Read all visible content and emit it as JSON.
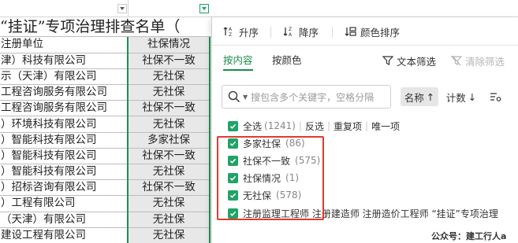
{
  "sheet": {
    "title": "“挂证”专项治理排查名单（",
    "header": {
      "col_a": "注册单位",
      "col_b": "社保情况"
    },
    "rows": [
      {
        "a": "津）科技有限公司",
        "b": "社保不一致"
      },
      {
        "a": "示（天津）有限公司",
        "b": "无社保"
      },
      {
        "a": "工程咨询服务有限公司",
        "b": "无社保"
      },
      {
        "a": "工程咨询服务有限公司",
        "b": "社保不一致"
      },
      {
        "a": "）环境科技有限公司",
        "b": "无社保"
      },
      {
        "a": "）智能科技有限公司",
        "b": "多家社保"
      },
      {
        "a": "）智能科技有限公司",
        "b": "社保不一致"
      },
      {
        "a": "）智能科技有限公司",
        "b": "无社保"
      },
      {
        "a": "）招标咨询有限公司",
        "b": "社保不一致"
      },
      {
        "a": "）工程有限公司",
        "b": "无社保"
      },
      {
        "a": "（天津）有限公司",
        "b": "无社保"
      },
      {
        "a": "建设工程有限公司",
        "b": "无社保"
      }
    ]
  },
  "panel": {
    "toolbar": {
      "asc": "升序",
      "desc": "降序",
      "color_sort": "颜色排序"
    },
    "tabs": {
      "by_content": "按内容",
      "by_color": "按颜色"
    },
    "text_filter": "文本筛选",
    "clear_filter": "清除筛选",
    "search": {
      "placeholder": "搜包含多个关键字，空格分隔"
    },
    "sort": {
      "name": "名称",
      "count": "计数"
    },
    "quick": {
      "select_all": "全选",
      "select_all_count": "(1241)",
      "invert": "反选",
      "duplicates": "重复项",
      "unique": "唯一项"
    },
    "items": [
      {
        "label": "多家社保",
        "count": "(86)"
      },
      {
        "label": "社保不一致",
        "count": "(575)"
      },
      {
        "label": "社保情况",
        "count": "(1)"
      },
      {
        "label": "无社保",
        "count": "(578)"
      },
      {
        "label": "注册监理工程师 注册建造师 注册造价工程师 “挂证”专项治理",
        "count": ""
      }
    ],
    "accent_color": "#1a8a4c",
    "highlight_color": "#e23a2e"
  },
  "watermark": "公众号：建工行人a"
}
